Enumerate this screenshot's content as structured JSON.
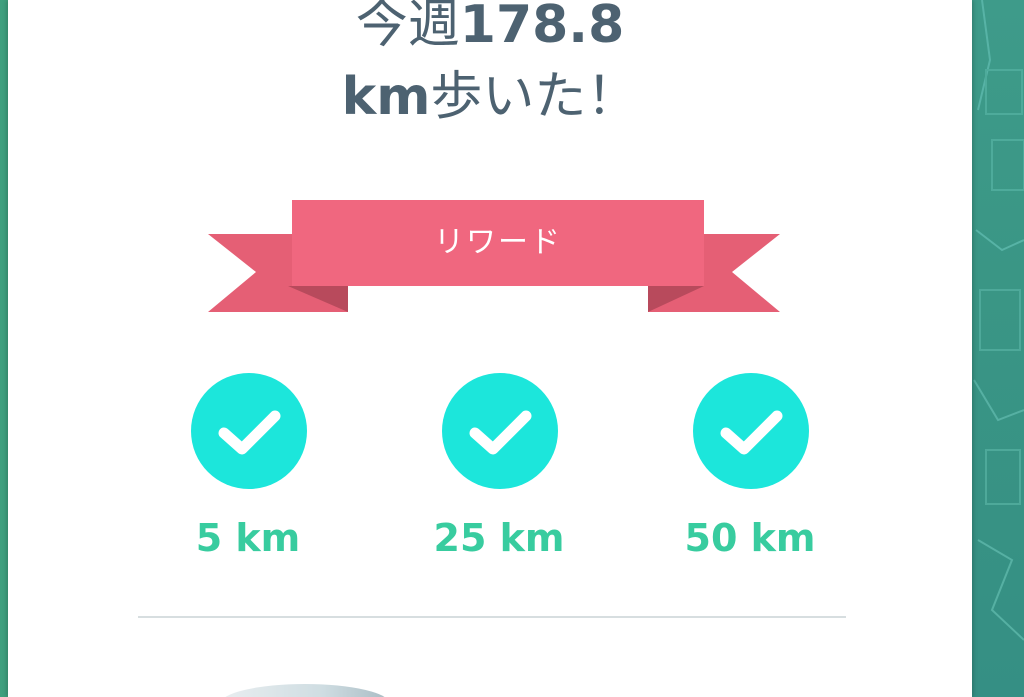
{
  "headline": {
    "prefix": "今週",
    "distance": "178.8",
    "unit": "km",
    "suffix": "歩いた！"
  },
  "ribbon": {
    "label": "リワード",
    "color": "#f0677f"
  },
  "milestones": [
    {
      "label": "5 km",
      "completed": true
    },
    {
      "label": "25 km",
      "completed": true
    },
    {
      "label": "50 km",
      "completed": true
    }
  ],
  "colors": {
    "headline_text": "#4d6271",
    "milestone_circle": "#1ce6db",
    "milestone_text": "#38cc9f",
    "map_background": "#3f9f86"
  }
}
